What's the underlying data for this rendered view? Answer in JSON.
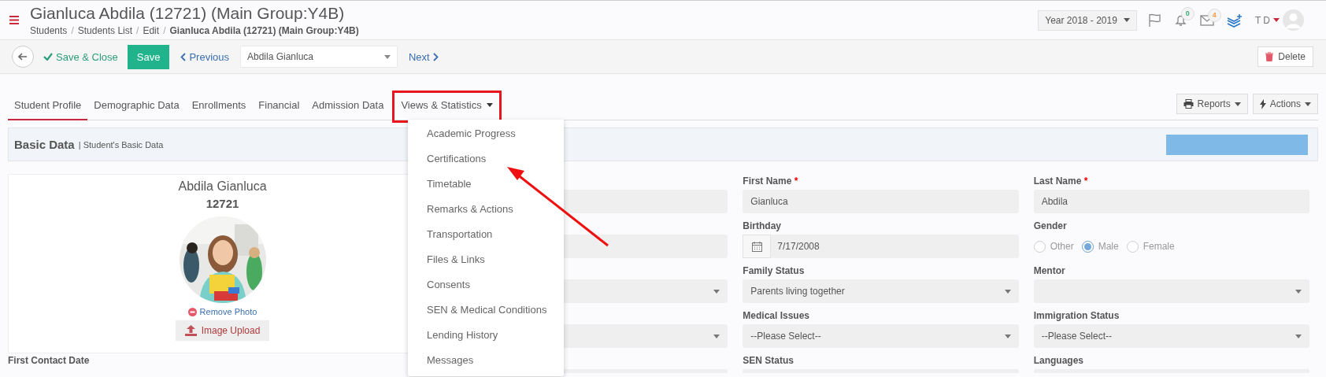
{
  "header": {
    "title": "Gianluca Abdila (12721) (Main Group:Y4B)",
    "breadcrumb_separator": "/",
    "breadcrumb": [
      {
        "label": "Students",
        "current": false
      },
      {
        "label": "Students List",
        "current": false
      },
      {
        "label": "Edit",
        "current": false
      },
      {
        "label": "Gianluca Abdila (12721) (Main Group:Y4B)",
        "current": true
      }
    ],
    "year": "Year 2018 - 2019",
    "notifications": "0",
    "messages": "4",
    "user": "T D"
  },
  "toolbar": {
    "save_close": "Save & Close",
    "save": "Save",
    "previous": "Previous",
    "student_select": "Abdila Gianluca",
    "next": "Next",
    "delete": "Delete"
  },
  "tabs": [
    {
      "label": "Student Profile",
      "selected": true,
      "has_menu": false,
      "highlighted": false
    },
    {
      "label": "Demographic Data",
      "selected": false,
      "has_menu": false,
      "highlighted": false
    },
    {
      "label": "Enrollments",
      "selected": false,
      "has_menu": false,
      "highlighted": false
    },
    {
      "label": "Financial",
      "selected": false,
      "has_menu": false,
      "highlighted": false
    },
    {
      "label": "Admission Data",
      "selected": false,
      "has_menu": false,
      "highlighted": false
    },
    {
      "label": "Views & Statistics",
      "selected": false,
      "has_menu": true,
      "highlighted": true
    }
  ],
  "tab_actions": [
    {
      "label": "Reports",
      "kind": "print"
    },
    {
      "label": "Actions",
      "kind": "bolt"
    }
  ],
  "dropdown": {
    "open": true,
    "items": [
      "Academic Progress",
      "Certifications",
      "Timetable",
      "Remarks & Actions",
      "Transportation",
      "Files & Links",
      "Consents",
      "SEN & Medical Conditions",
      "Lending History",
      "Messages"
    ]
  },
  "section": {
    "title": "Basic Data",
    "subtitle": "| Student's Basic Data"
  },
  "profile": {
    "name": "Abdila Gianluca",
    "id": "12721",
    "remove": "Remove Photo",
    "upload": "Image Upload"
  },
  "first_contact_label": "First Contact Date",
  "form_columns": [
    [
      {
        "kind": "text"
      },
      {
        "kind": "text"
      },
      {
        "kind": "select"
      },
      {
        "kind": "select"
      },
      {
        "kind": "text"
      }
    ],
    [
      {
        "kind": "text",
        "label": "First Name",
        "required_mark": "*",
        "value": "Gianluca"
      },
      {
        "kind": "date",
        "label": "Birthday",
        "value": "7/17/2008"
      },
      {
        "kind": "select",
        "label": "Family Status",
        "value": "Parents living together"
      },
      {
        "kind": "select",
        "label": "Medical Issues",
        "value": "--Please Select--"
      },
      {
        "kind": "text",
        "label": "SEN Status"
      }
    ],
    [
      {
        "kind": "text",
        "label": "Last Name",
        "required_mark": "*",
        "value": "Abdila"
      },
      {
        "kind": "radio",
        "label": "Gender",
        "options": [
          {
            "label": "Other",
            "selected": false
          },
          {
            "label": "Male",
            "selected": true
          },
          {
            "label": "Female",
            "selected": false
          }
        ]
      },
      {
        "kind": "select",
        "label": "Mentor"
      },
      {
        "kind": "select",
        "label": "Immigration Status",
        "value": "--Please Select--"
      },
      {
        "kind": "text",
        "label": "Languages"
      }
    ]
  ]
}
